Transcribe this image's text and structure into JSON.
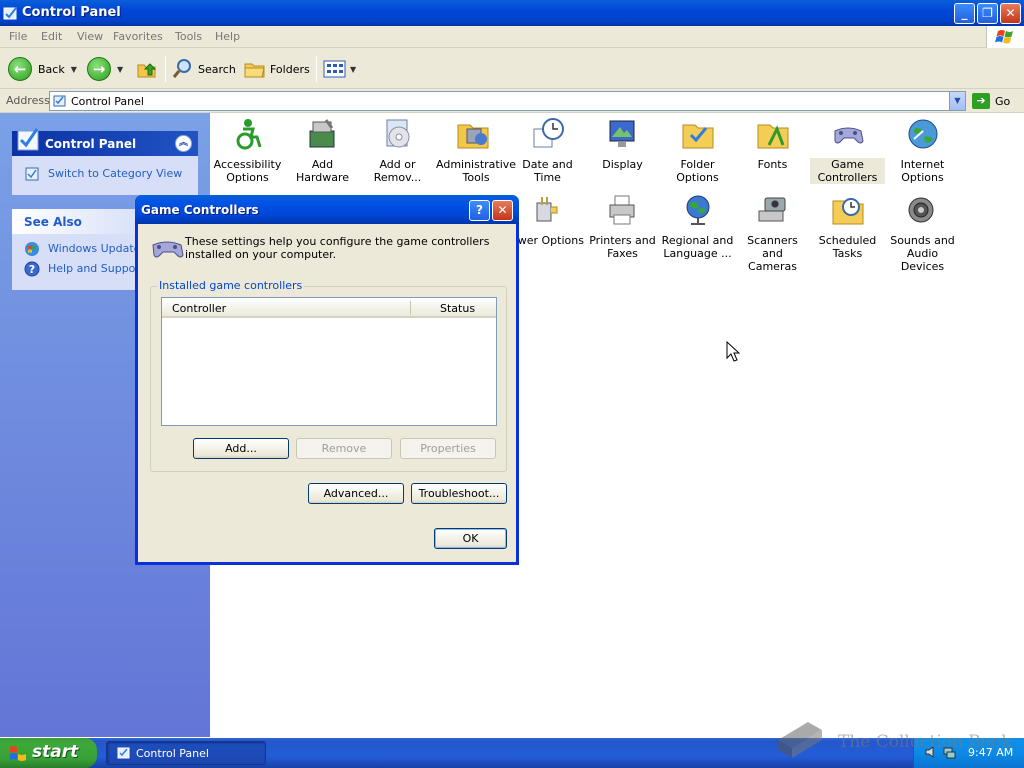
{
  "window": {
    "title": "Control Panel",
    "controls": {
      "minimize": "_",
      "restore": "❐",
      "close": "✕"
    }
  },
  "menu": [
    "File",
    "Edit",
    "View",
    "Favorites",
    "Tools",
    "Help"
  ],
  "toolbar": {
    "back_label": "Back",
    "search_label": "Search",
    "folders_label": "Folders"
  },
  "address": {
    "label": "Address",
    "value": "Control Panel",
    "go_label": "Go"
  },
  "taskpane": {
    "control_panel": {
      "title": "Control Panel",
      "links": [
        {
          "label": "Switch to Category View",
          "icon": "category-view-icon"
        }
      ]
    },
    "see_also": {
      "title": "See Also",
      "links": [
        {
          "label": "Windows Update",
          "icon": "windows-update-icon"
        },
        {
          "label": "Help and Support",
          "icon": "help-icon"
        }
      ]
    }
  },
  "items": [
    {
      "label": "Accessibility Options",
      "icon": "accessibility-icon"
    },
    {
      "label": "Add Hardware",
      "icon": "add-hardware-icon"
    },
    {
      "label": "Add or Remov...",
      "icon": "add-remove-programs-icon"
    },
    {
      "label": "Administrative Tools",
      "icon": "admin-tools-icon"
    },
    {
      "label": "Date and Time",
      "icon": "date-time-icon"
    },
    {
      "label": "Display",
      "icon": "display-icon"
    },
    {
      "label": "Folder Options",
      "icon": "folder-options-icon"
    },
    {
      "label": "Fonts",
      "icon": "fonts-icon"
    },
    {
      "label": "Game Controllers",
      "icon": "game-controllers-icon",
      "selected": true
    },
    {
      "label": "Internet Options",
      "icon": "internet-options-icon"
    },
    {
      "label": "ower Options",
      "icon": "power-options-icon"
    },
    {
      "label": "Printers and Faxes",
      "icon": "printers-icon"
    },
    {
      "label": "Regional and Language ...",
      "icon": "regional-icon"
    },
    {
      "label": "Scanners and Cameras",
      "icon": "scanners-icon"
    },
    {
      "label": "Scheduled Tasks",
      "icon": "scheduled-tasks-icon"
    },
    {
      "label": "Sounds and Audio Devices",
      "icon": "sounds-icon"
    }
  ],
  "dialog": {
    "title": "Game Controllers",
    "help_btn": "?",
    "close_btn": "✕",
    "intro": "These settings help you configure the game controllers installed on your computer.",
    "group_label": "Installed game controllers",
    "columns": [
      "Controller",
      "Status"
    ],
    "rows": [],
    "buttons": {
      "add": "Add...",
      "remove": "Remove",
      "properties": "Properties",
      "advanced": "Advanced...",
      "troubleshoot": "Troubleshoot...",
      "ok": "OK"
    }
  },
  "taskbar": {
    "start_label": "start",
    "task_label": "Control Panel",
    "clock": "9:47 AM"
  },
  "watermark": "The Collection Book",
  "colors": {
    "xp_blue": "#0046d8",
    "taskpane": "#6f8fdf",
    "start_green": "#3da83a",
    "link_blue": "#215dc6"
  }
}
